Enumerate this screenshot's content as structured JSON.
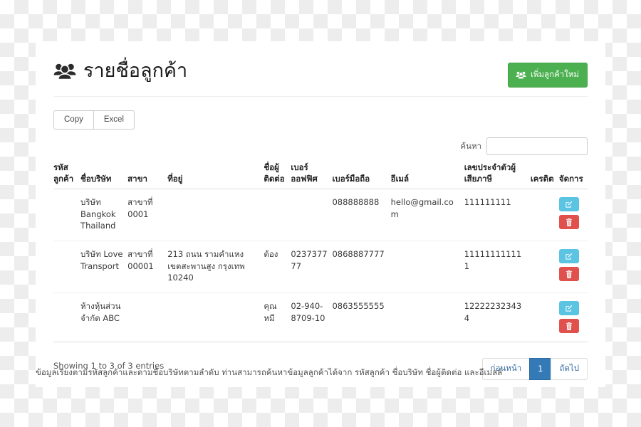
{
  "header": {
    "title": "รายชื่อลูกค้า",
    "title_icon": "users-icon",
    "add_button_label": "เพิ่มลูกค้าใหม่",
    "add_button_icon": "users-icon",
    "add_button_color": "#4cb050"
  },
  "toolbar": {
    "copy_label": "Copy",
    "excel_label": "Excel"
  },
  "search": {
    "label": "ค้นหา",
    "value": "",
    "placeholder": ""
  },
  "table": {
    "columns": [
      {
        "key": "code",
        "label": "รหัสลูกค้า"
      },
      {
        "key": "company",
        "label": "ชื่อบริษัท"
      },
      {
        "key": "branch",
        "label": "สาขา"
      },
      {
        "key": "address",
        "label": "ที่อยู่"
      },
      {
        "key": "contact",
        "label": "ชื่อผู้ติดต่อ"
      },
      {
        "key": "office",
        "label": "เบอร์ออฟฟิศ"
      },
      {
        "key": "mobile",
        "label": "เบอร์มือถือ"
      },
      {
        "key": "email",
        "label": "อีเมล์"
      },
      {
        "key": "tax",
        "label": "เลขประจำตัวผู้เสียภาษี"
      },
      {
        "key": "credit",
        "label": "เครดิต"
      },
      {
        "key": "manage",
        "label": "จัดการ"
      }
    ],
    "rows": [
      {
        "code": "",
        "company": "บริษัท Bangkok Thailand",
        "branch": "สาขาที่ 0001",
        "address": "",
        "contact": "",
        "office": "",
        "mobile": "088888888",
        "email": "hello@gmail.com",
        "tax": "111111111",
        "credit": "",
        "edit_icon": "pencil-square-icon",
        "delete_icon": "trash-icon"
      },
      {
        "code": "",
        "company": "บริษัท Love Transport",
        "branch": "สาขาที่ 00001",
        "address": "213 ถนน รามคำแหง เขตสะพานสูง กรุงเทพ 10240",
        "contact": "ต้อง",
        "office": "023737777",
        "mobile": "0868887777",
        "email": "",
        "tax": "111111111111",
        "credit": "",
        "edit_icon": "pencil-square-icon",
        "delete_icon": "trash-icon"
      },
      {
        "code": "",
        "company": "ห้างหุ้นส่วนจำกัด ABC",
        "branch": "",
        "address": "",
        "contact": "คุณ หมี",
        "office": "02-940-8709-10",
        "mobile": "0863555555",
        "email": "",
        "tax": "122222323434",
        "credit": "",
        "edit_icon": "pencil-square-icon",
        "delete_icon": "trash-icon"
      }
    ]
  },
  "footer": {
    "entries_info": "Showing 1 to 3 of 3 entries",
    "pagination": {
      "previous_label": "ก่อนหน้า",
      "page_1_label": "1",
      "next_label": "ถัดไป",
      "active_page": "1",
      "active_color": "#337ab7"
    },
    "note": "ข้อมูลเรียงตามรหัสลูกค้าและตามชื่อบริษัทตามลำดับ ท่านสามารถค้นหาข้อมูลลูกค้าได้จาก รหัสลูกค้า ชื่อบริษัท ชื่อผู้ติดต่อ และอีเมลล์"
  },
  "colors": {
    "edit_button": "#5bc4e3",
    "delete_button": "#e0504d",
    "add_button": "#4cb050",
    "pagination_active": "#337ab7"
  }
}
